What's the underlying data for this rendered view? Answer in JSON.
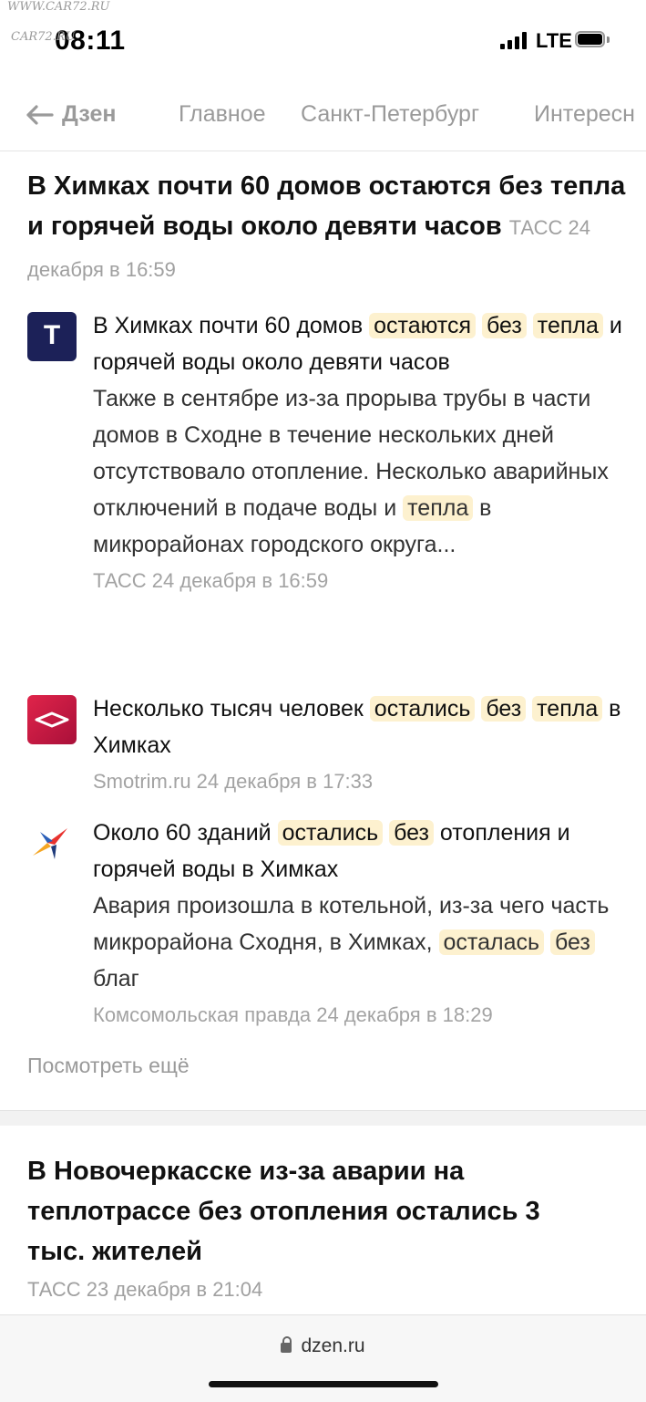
{
  "status": {
    "watermark_top": "WWW.CAR72.RU",
    "watermark_overlay": "CAR72.RU",
    "time": "08:11",
    "network": "LTE"
  },
  "nav": {
    "back_label": "Дзен",
    "tabs": [
      "Главное",
      "Санкт-Петербург",
      "Интересн"
    ]
  },
  "story1": {
    "headline": "В Химках почти 60 домов остаются без тепла и горячей воды около девяти часов",
    "meta": "ТАСС 24 декабря в 16:59",
    "items": [
      {
        "logo": "Т",
        "title_parts": [
          {
            "t": "В Химках почти 60 домов ",
            "h": false
          },
          {
            "t": "остаются",
            "h": true
          },
          {
            "t": " ",
            "h": false
          },
          {
            "t": "без",
            "h": true
          },
          {
            "t": " ",
            "h": false
          },
          {
            "t": "тепла",
            "h": true
          },
          {
            "t": " и горячей воды около девяти часов",
            "h": false
          }
        ],
        "snippet_parts": [
          {
            "t": "Также в сентябре из-за прорыва трубы в части домов в Сходне в течение нескольких дней отсутствовало отопление. Несколько аварийных отключений в подаче воды и ",
            "h": false
          },
          {
            "t": "тепла",
            "h": true
          },
          {
            "t": " в микрорайонах городского округа...",
            "h": false
          }
        ],
        "source": "ТАСС 24 декабря в 16:59"
      },
      {
        "title_parts": [
          {
            "t": "Несколько тысяч человек ",
            "h": false
          },
          {
            "t": "остались",
            "h": true
          },
          {
            "t": " ",
            "h": false
          },
          {
            "t": "без",
            "h": true
          },
          {
            "t": " ",
            "h": false
          },
          {
            "t": "тепла",
            "h": true
          },
          {
            "t": " в Химках",
            "h": false
          }
        ],
        "source": "Smotrim.ru 24 декабря в 17:33"
      },
      {
        "title_parts": [
          {
            "t": "Около 60 зданий ",
            "h": false
          },
          {
            "t": "остались",
            "h": true
          },
          {
            "t": " ",
            "h": false
          },
          {
            "t": "без",
            "h": true
          },
          {
            "t": " отопления и горячей воды в Химках",
            "h": false
          }
        ],
        "snippet_parts": [
          {
            "t": "Авария произошла в котельной, из-за чего часть микрорайона Сходня, в Химках, ",
            "h": false
          },
          {
            "t": "осталась",
            "h": true
          },
          {
            "t": " ",
            "h": false
          },
          {
            "t": "без",
            "h": true
          },
          {
            "t": " благ",
            "h": false
          }
        ],
        "source": "Комсомольская правда 24 декабря в 18:29"
      }
    ],
    "more_label": "Посмотреть ещё"
  },
  "story2": {
    "headline": "В Новочеркасске из-за аварии на теплотрассе без отопления остались 3 тыс. жителей",
    "meta": "ТАСС 23 декабря в 21:04"
  },
  "browser": {
    "url": "dzen.ru"
  },
  "colors": {
    "highlight": "#fdf1cf",
    "tass_logo": "#1c2158",
    "smotrim_logo": "#c61a3e"
  }
}
